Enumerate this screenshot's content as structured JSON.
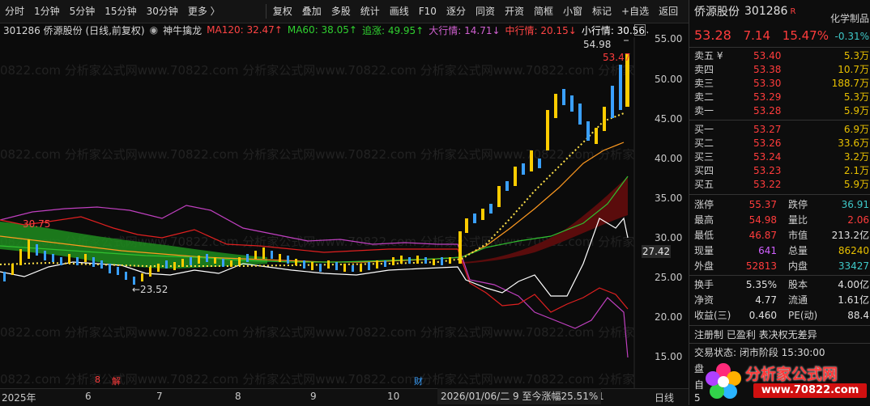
{
  "toolbar": {
    "items": [
      "分时",
      "1分钟",
      "5分钟",
      "15分钟",
      "30分钟",
      "更多 〉",
      "复权",
      "叠加",
      "多股",
      "统计",
      "画线",
      "F10",
      "逐分",
      "同资",
      "开资",
      "简框",
      "小窗",
      "标记",
      "+自选",
      "返回"
    ]
  },
  "indicators": {
    "title": "301286 侨源股份 (日线,前复权)",
    "tool": "神牛擒龙",
    "ma120": "MA120: 32.47↑",
    "ma60": "MA60: 38.05↑",
    "chase": "追涨: 49.95↑",
    "big": "大行情: 14.71↓",
    "mid": "中行情: 20.15↓",
    "small": "小行情: 30.56↓"
  },
  "chart_labels": {
    "high_mark": "54.98",
    "last_mark": "53.47",
    "low_mark": "←23.52",
    "left_mark": "30.75",
    "current": "27.42",
    "event1": "8",
    "event2": "解",
    "event3": "财"
  },
  "price_axis": [
    "55.00",
    "50.00",
    "45.00",
    "40.00",
    "35.00",
    "30.00",
    "25.00",
    "20.00",
    "15.00"
  ],
  "time_axis": {
    "labels": [
      "2025年",
      "6",
      "7",
      "8",
      "9",
      "10",
      "2",
      "1"
    ],
    "range": "2026/01/06/二 9 至今涨幅25.51%",
    "period": "日线"
  },
  "watermark": "0822.com 分析家公式网www.70822.com 分析家公式网www.70822.com 分析家公式网www.70822.com 分析家",
  "quote": {
    "name": "侨源股份",
    "code": "301286",
    "badge": "R",
    "sector": "化学制品",
    "sector_change": "-0.31%",
    "price": "53.28",
    "change": "7.14",
    "pct": "15.47%"
  },
  "sell": [
    {
      "label": "卖五 ¥",
      "price": "53.40",
      "vol": "5.3万"
    },
    {
      "label": "卖四",
      "price": "53.38",
      "vol": "10.7万"
    },
    {
      "label": "卖三",
      "price": "53.30",
      "vol": "188.7万"
    },
    {
      "label": "卖二",
      "price": "53.29",
      "vol": "5.3万"
    },
    {
      "label": "卖一",
      "price": "53.28",
      "vol": "5.9万"
    }
  ],
  "buy": [
    {
      "label": "买一",
      "price": "53.27",
      "vol": "6.9万"
    },
    {
      "label": "买二",
      "price": "53.26",
      "vol": "33.6万"
    },
    {
      "label": "买三",
      "price": "53.24",
      "vol": "3.2万"
    },
    {
      "label": "买四",
      "price": "53.23",
      "vol": "2.1万"
    },
    {
      "label": "买五",
      "price": "53.22",
      "vol": "5.9万"
    }
  ],
  "stats": [
    {
      "a": "涨停",
      "b": "55.37",
      "bc": "red",
      "c": "跌停",
      "d": "36.91",
      "dc": "green"
    },
    {
      "a": "最高",
      "b": "54.98",
      "bc": "red",
      "c": "量比",
      "d": "2.06",
      "dc": "red"
    },
    {
      "a": "最低",
      "b": "46.87",
      "bc": "red",
      "c": "市值",
      "d": "213.2亿",
      "dc": "white"
    },
    {
      "a": "现量",
      "b": "641",
      "bc": "yellow",
      "c": "总量",
      "d": "86240",
      "dc": "yellow"
    },
    {
      "a": "外盘",
      "b": "52813",
      "bc": "red",
      "c": "内盘",
      "d": "33427",
      "dc": "green"
    }
  ],
  "stats2": [
    {
      "a": "换手",
      "b": "5.35%",
      "bc": "white",
      "c": "股本",
      "d": "4.00亿",
      "dc": "white"
    },
    {
      "a": "净资",
      "b": "4.77",
      "bc": "white",
      "c": "流通",
      "d": "1.61亿",
      "dc": "white"
    },
    {
      "a": "收益(三)",
      "b": "0.460",
      "bc": "white",
      "c": "PE(动)",
      "d": "88.4",
      "dc": "white"
    }
  ],
  "info": {
    "reg": "注册制 已盈利 表决权无差异",
    "status": "交易状态: 闭市阶段 15:30:00",
    "line3": "盘",
    "line4": "自",
    "line5": "5"
  },
  "logo": {
    "title": "分析家公式网",
    "url": "www.70822.com"
  }
}
